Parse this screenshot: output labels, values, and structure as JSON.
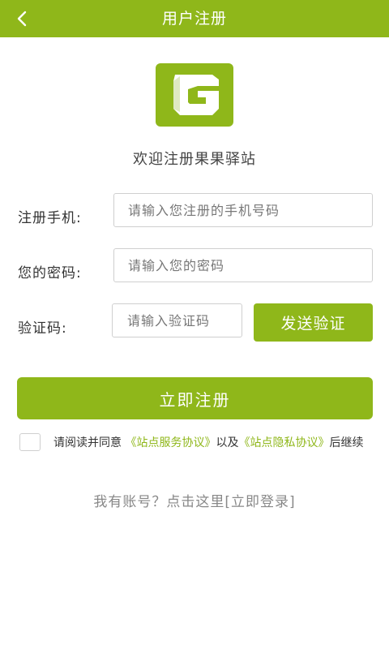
{
  "header": {
    "title": "用户注册",
    "back_icon": "chevron-left-icon"
  },
  "logo": {
    "letter": "G",
    "icon": "app-logo-icon",
    "color": "#8fb71a"
  },
  "welcome": "欢迎注册果果驿站",
  "form": {
    "phone": {
      "label": "注册手机:",
      "placeholder": "请输入您注册的手机号码",
      "value": ""
    },
    "password": {
      "label": "您的密码:",
      "placeholder": "请输入您的密码",
      "value": ""
    },
    "code": {
      "label": "验证码:",
      "placeholder": "请输入验证码",
      "value": ""
    },
    "send_button": "发送验证",
    "submit_button": "立即注册"
  },
  "agreement": {
    "checked": false,
    "prefix": "请阅读并同意",
    "service_link": "《站点服务协议》",
    "middle": "以及",
    "privacy_link": "《站点隐私协议》",
    "suffix": "后继续"
  },
  "login_prompt": "我有账号？点击这里[立即登录]",
  "colors": {
    "accent": "#8fb71a",
    "border": "#cfcfcf"
  }
}
